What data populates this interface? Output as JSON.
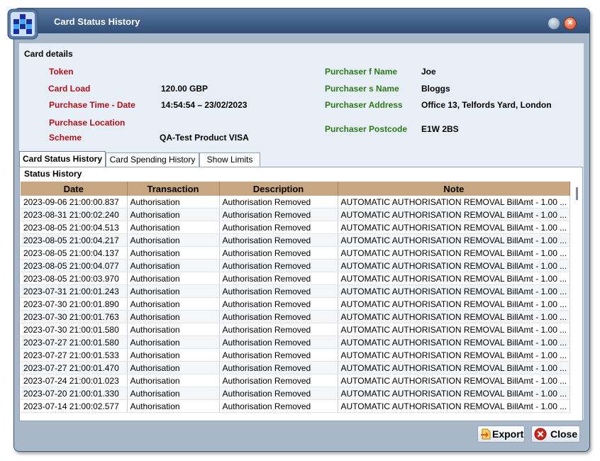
{
  "window": {
    "title": "Card Status History"
  },
  "card_details": {
    "section_title": "Card details",
    "left": [
      {
        "label": "Token",
        "value": ""
      },
      {
        "label": "Card Load",
        "value": "120.00 GBP"
      },
      {
        "label": "Purchase Time - Date",
        "value": "14:54:54 – 23/02/2023"
      },
      {
        "label": "Purchase Location",
        "value": ""
      },
      {
        "label": "Scheme",
        "value": "QA-Test Product VISA"
      }
    ],
    "right": [
      {
        "label": "Purchaser f Name",
        "value": "Joe"
      },
      {
        "label": "Purchaser s Name",
        "value": "Bloggs"
      },
      {
        "label": "Purchaser Address",
        "value": "Office 13, Telfords Yard, London"
      },
      {
        "label": "Purchaser Postcode",
        "value": "E1W 2BS"
      }
    ]
  },
  "tabs": [
    "Card Status History",
    "Card Spending History",
    "Show Limits"
  ],
  "status_history": {
    "title": "Status History",
    "columns": [
      "Date",
      "Transaction",
      "Description",
      "Note"
    ],
    "rows": [
      [
        "2023-09-06 21:00:00.837",
        "Authorisation",
        "Authorisation Removed",
        "AUTOMATIC AUTHORISATION REMOVAL BillAmt - 1.00 ..."
      ],
      [
        "2023-08-31 21:00:02.240",
        "Authorisation",
        "Authorisation Removed",
        "AUTOMATIC AUTHORISATION REMOVAL BillAmt - 1.00 ..."
      ],
      [
        "2023-08-05 21:00:04.513",
        "Authorisation",
        "Authorisation Removed",
        "AUTOMATIC AUTHORISATION REMOVAL BillAmt - 1.00 ..."
      ],
      [
        "2023-08-05 21:00:04.217",
        "Authorisation",
        "Authorisation Removed",
        "AUTOMATIC AUTHORISATION REMOVAL BillAmt - 1.00 ..."
      ],
      [
        "2023-08-05 21:00:04.137",
        "Authorisation",
        "Authorisation Removed",
        "AUTOMATIC AUTHORISATION REMOVAL BillAmt - 1.00 ..."
      ],
      [
        "2023-08-05 21:00:04.077",
        "Authorisation",
        "Authorisation Removed",
        "AUTOMATIC AUTHORISATION REMOVAL BillAmt - 1.00 ..."
      ],
      [
        "2023-08-05 21:00:03.970",
        "Authorisation",
        "Authorisation Removed",
        "AUTOMATIC AUTHORISATION REMOVAL BillAmt - 1.00 ..."
      ],
      [
        "2023-07-31 21:00:01.243",
        "Authorisation",
        "Authorisation Removed",
        "AUTOMATIC AUTHORISATION REMOVAL BillAmt - 1.00 ..."
      ],
      [
        "2023-07-30 21:00:01.890",
        "Authorisation",
        "Authorisation Removed",
        "AUTOMATIC AUTHORISATION REMOVAL BillAmt - 1.00 ..."
      ],
      [
        "2023-07-30 21:00:01.763",
        "Authorisation",
        "Authorisation Removed",
        "AUTOMATIC AUTHORISATION REMOVAL BillAmt - 1.00 ..."
      ],
      [
        "2023-07-30 21:00:01.580",
        "Authorisation",
        "Authorisation Removed",
        "AUTOMATIC AUTHORISATION REMOVAL BillAmt - 1.00 ..."
      ],
      [
        "2023-07-27 21:00:01.580",
        "Authorisation",
        "Authorisation Removed",
        "AUTOMATIC AUTHORISATION REMOVAL BillAmt - 1.00 ..."
      ],
      [
        "2023-07-27 21:00:01.533",
        "Authorisation",
        "Authorisation Removed",
        "AUTOMATIC AUTHORISATION REMOVAL BillAmt - 1.00 ..."
      ],
      [
        "2023-07-27 21:00:01.470",
        "Authorisation",
        "Authorisation Removed",
        "AUTOMATIC AUTHORISATION REMOVAL BillAmt - 1.00 ..."
      ],
      [
        "2023-07-24 21:00:01.023",
        "Authorisation",
        "Authorisation Removed",
        "AUTOMATIC AUTHORISATION REMOVAL BillAmt - 1.00 ..."
      ],
      [
        "2023-07-20 21:00:01.330",
        "Authorisation",
        "Authorisation Removed",
        "AUTOMATIC AUTHORISATION REMOVAL BillAmt - 1.00 ..."
      ],
      [
        "2023-07-14 21:00:02.577",
        "Authorisation",
        "Authorisation Removed",
        "AUTOMATIC AUTHORISATION REMOVAL BillAmt - 1.00 ..."
      ]
    ]
  },
  "buttons": {
    "export": "Export",
    "close": "Close"
  },
  "colors": {
    "label_red": "#b0101a",
    "label_green": "#2d7a1b",
    "header_tan": "#c8a882",
    "title_bar": "#2f4d75"
  }
}
